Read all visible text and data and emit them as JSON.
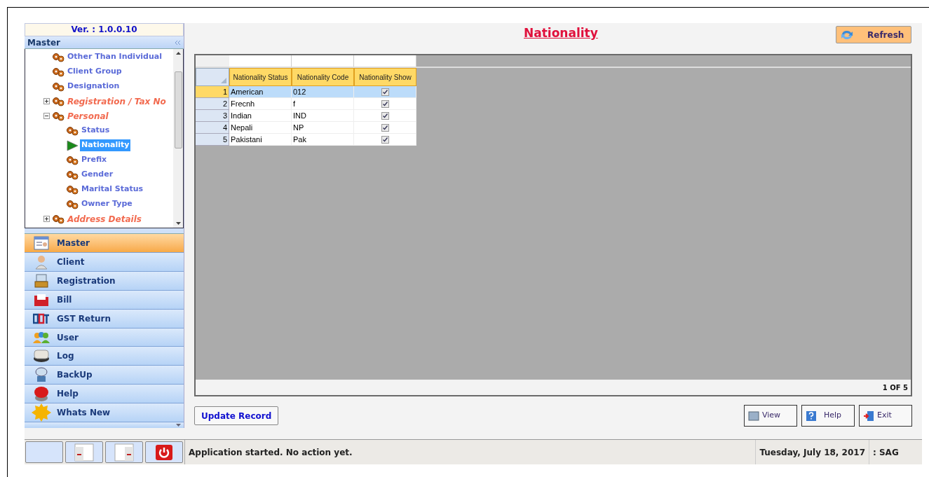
{
  "sidebar": {
    "version": "Ver. : 1.0.0.10",
    "panel_title": "Master",
    "tree": [
      {
        "label": "Other Than Individual",
        "kind": "item",
        "selected": false
      },
      {
        "label": "Client Group",
        "kind": "item",
        "selected": false
      },
      {
        "label": "Designation",
        "kind": "item",
        "selected": false
      },
      {
        "label": "Registration / Tax No",
        "kind": "group",
        "expanded": false,
        "selected": false
      },
      {
        "label": "Personal",
        "kind": "group",
        "expanded": true,
        "selected": false,
        "children": [
          {
            "label": "Status",
            "kind": "item",
            "selected": false
          },
          {
            "label": "Nationality",
            "kind": "item",
            "selected": true
          },
          {
            "label": "Prefix",
            "kind": "item",
            "selected": false
          },
          {
            "label": "Gender",
            "kind": "item",
            "selected": false
          },
          {
            "label": "Marital Status",
            "kind": "item",
            "selected": false
          },
          {
            "label": "Owner Type",
            "kind": "item",
            "selected": false
          }
        ]
      },
      {
        "label": "Address Details",
        "kind": "group",
        "expanded": false,
        "selected": false
      }
    ],
    "nav": [
      {
        "label": "Master",
        "selected": true
      },
      {
        "label": "Client",
        "selected": false
      },
      {
        "label": "Registration",
        "selected": false
      },
      {
        "label": "Bill",
        "selected": false
      },
      {
        "label": "GST Return",
        "selected": false
      },
      {
        "label": "User",
        "selected": false
      },
      {
        "label": "Log",
        "selected": false
      },
      {
        "label": "BackUp",
        "selected": false
      },
      {
        "label": "Help",
        "selected": false
      },
      {
        "label": "Whats New",
        "selected": false
      }
    ]
  },
  "page_title": "Nationality",
  "refresh_button": "Refresh",
  "table": {
    "columns": [
      "Nationality Status",
      "Nationality Code",
      "Nationality Show"
    ],
    "rows": [
      {
        "number": "1",
        "status": "American",
        "code": "012",
        "show": true,
        "selected": true
      },
      {
        "number": "2",
        "status": "Frecnh",
        "code": "f",
        "show": true,
        "selected": false
      },
      {
        "number": "3",
        "status": "Indian",
        "code": "IND",
        "show": true,
        "selected": false
      },
      {
        "number": "4",
        "status": "Nepali",
        "code": "NP",
        "show": true,
        "selected": false
      },
      {
        "number": "5",
        "status": "Pakistani",
        "code": "Pak",
        "show": true,
        "selected": false
      }
    ],
    "pager": "1 OF 5"
  },
  "buttons": {
    "update": "Update Record",
    "view": "View",
    "help": "Help",
    "exit": "Exit"
  },
  "status_bar": {
    "message": "Application started. No action yet.",
    "date": "Tuesday, July 18, 2017",
    "user": ": SAG"
  }
}
